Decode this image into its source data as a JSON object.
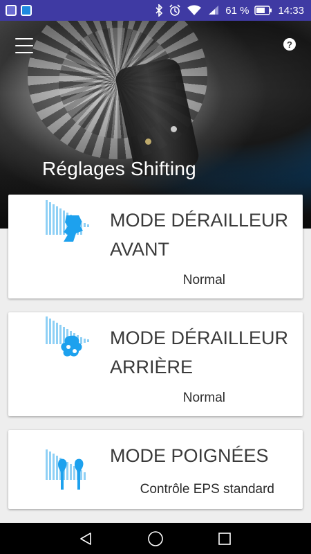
{
  "status_bar": {
    "battery_text": "61 %",
    "time": "14:33",
    "left_icons": [
      "app-notification-icon",
      "gallery-notification-icon"
    ],
    "right_icons": [
      "bluetooth-icon",
      "alarm-icon",
      "wifi-icon",
      "signal-icon",
      "battery-icon"
    ]
  },
  "header": {
    "title": "Réglages Shifting",
    "menu_icon": "hamburger-menu-icon",
    "help_icon": "help-icon",
    "help_glyph": "?"
  },
  "cards": [
    {
      "title": "MODE DÉRAILLEUR AVANT",
      "value": "Normal",
      "icon": "front-derailleur-icon"
    },
    {
      "title": "MODE DÉRAILLEUR ARRIÈRE",
      "value": "Normal",
      "icon": "rear-derailleur-icon"
    },
    {
      "title": "MODE POIGNÉES",
      "value": "Contrôle EPS standard",
      "icon": "shifter-levers-icon"
    }
  ],
  "colors": {
    "status_bar": "#3f3aa3",
    "accent_blue": "#1da1ee",
    "background": "#eeeeee"
  },
  "navigation": {
    "icons": [
      "back-icon",
      "home-icon",
      "recent-apps-icon"
    ]
  }
}
